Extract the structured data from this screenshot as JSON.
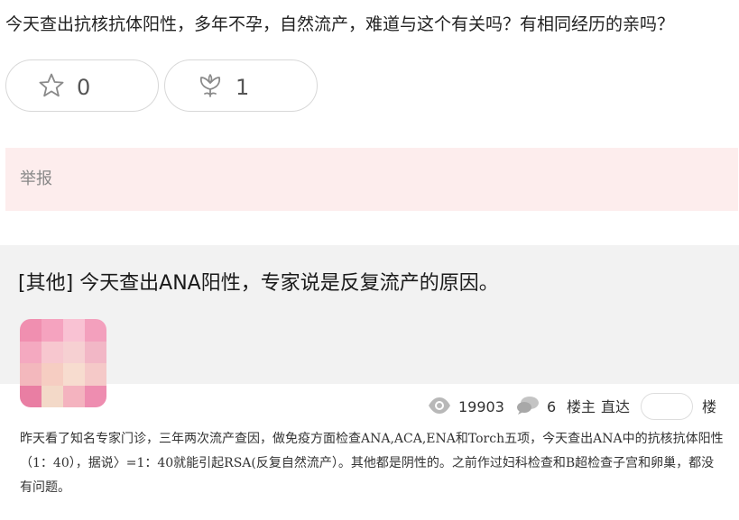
{
  "question": {
    "title": "今天查出抗核抗体阳性，多年不孕，自然流产，难道与这个有关吗？有相同经历的亲吗？"
  },
  "actions": {
    "like_count": "0",
    "flower_count": "1"
  },
  "report": {
    "label": "举报"
  },
  "post": {
    "title": "[其他] 今天查出ANA阳性，专家说是反复流产的原因。",
    "views": "19903",
    "comments": "6",
    "owner_label": "楼主",
    "goto_label": "直达",
    "floor_input_value": "",
    "floor_suffix": "楼",
    "body": "昨天看了知名专家门诊，三年两次流产查因，做免疫方面检查ANA,ACA,ENA和Torch五项，今天查出ANA中的抗核抗体阳性（1：40），据说〉=1：40就能引起RSA(反复自然流产）。其他都是阴性的。之前作过妇科检查和B超检查子宫和卵巢，都没有问题。"
  },
  "colors": {
    "report_bg": "#fdeded",
    "card_bg": "#f2f2f2",
    "border": "#d8d8d8"
  },
  "icons": {
    "like": "star-outline-icon",
    "flower": "flower-icon",
    "views": "eye-icon",
    "comments": "chat-bubbles-icon"
  }
}
